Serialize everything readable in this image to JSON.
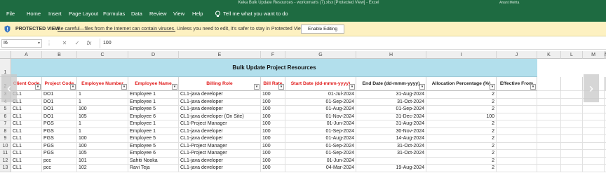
{
  "window": {
    "title": "Keka Bulk Update Resources - workomarts (7).xlsx  [Protected View]  -  Excel",
    "user": "Anant Mehta"
  },
  "ribbon": {
    "tabs": [
      "File",
      "Home",
      "Insert",
      "Page Layout",
      "Formulas",
      "Data",
      "Review",
      "View",
      "Help"
    ],
    "tell_me": "Tell me what you want to do"
  },
  "protected_view": {
    "label": "PROTECTED VIEW",
    "message_link": "Be careful—files from the Internet can contain viruses.",
    "message_rest": " Unless you need to edit, it's safer to stay in Protected View.",
    "button": "Enable Editing"
  },
  "formula_bar": {
    "name_box": "I6",
    "sep": "⋮",
    "cancel": "✕",
    "enter": "✓",
    "fx": "fx",
    "value": "100"
  },
  "columns": [
    "A",
    "B",
    "C",
    "D",
    "E",
    "F",
    "G",
    "H",
    "I",
    "J",
    "K",
    "L",
    "M",
    "N"
  ],
  "row_numbers": [
    "1",
    "2",
    "3",
    "4",
    "5",
    "6",
    "7",
    "8",
    "9",
    "10",
    "11",
    "12",
    "13"
  ],
  "sheet": {
    "banner": "Bulk Update Project Resources",
    "headers": [
      "Client Code",
      "Project Code",
      "Employee Number",
      "Employee Name",
      "Billing Role",
      "Bill Rate",
      "Start Date (dd-mmm-yyyy)",
      "End Date (dd-mmm-yyyy)",
      "Allocation Percentage (%)",
      "Effective From"
    ],
    "rows": [
      [
        "CL1",
        "DO1",
        "1",
        "Employee 1",
        "CL1-java developer",
        "100",
        "01-Jul-2024",
        "31-Aug-2024",
        "2",
        ""
      ],
      [
        "CL1",
        "DO1",
        "1",
        "Employee 1",
        "CL1-java developer",
        "100",
        "01-Sep-2024",
        "31-Oct-2024",
        "2",
        ""
      ],
      [
        "CL1",
        "DO1",
        "100",
        "Employee 5",
        "CL1-java developer",
        "100",
        "01-Aug-2024",
        "01-Sep-2024",
        "2",
        ""
      ],
      [
        "CL1",
        "DO1",
        "105",
        "Employee 6",
        "CL1-java developer (On Site)",
        "100",
        "01-Nov-2024",
        "31-Dec-2024",
        "100",
        ""
      ],
      [
        "CL1",
        "PGS",
        "1",
        "Employee 1",
        "CL1-Project Manager",
        "100",
        "01-Jun-2024",
        "31-Aug-2024",
        "2",
        ""
      ],
      [
        "CL1",
        "PGS",
        "1",
        "Employee 1",
        "CL1-java developer",
        "100",
        "01-Sep-2024",
        "30-Nov-2024",
        "2",
        ""
      ],
      [
        "CL1",
        "PGS",
        "100",
        "Employee 5",
        "CL1-java developer",
        "100",
        "01-Aug-2024",
        "14-Aug-2024",
        "2",
        ""
      ],
      [
        "CL1",
        "PGS",
        "100",
        "Employee 5",
        "CL1-Project Manager",
        "100",
        "01-Sep-2024",
        "31-Oct-2024",
        "2",
        ""
      ],
      [
        "CL1",
        "PGS",
        "105",
        "Employee 6",
        "CL1-Project Manager",
        "100",
        "01-Sep-2024",
        "31-Oct-2024",
        "2",
        ""
      ],
      [
        "CL1",
        "pcc",
        "101",
        "Sahiti Nooka",
        "CL1-java developer",
        "100",
        "01-Jun-2024",
        "",
        "2",
        ""
      ],
      [
        "CL1",
        "pcc",
        "102",
        "Ravi Teja",
        "CL1-java developer",
        "100",
        "04-Mar-2024",
        "19-Aug-2024",
        "2",
        ""
      ]
    ]
  },
  "nav": {
    "prev": "‹",
    "next": "›"
  },
  "colors": {
    "excel_green": "#1e6b41",
    "banner_blue": "#b2dfec",
    "header_red": "#e01a1a",
    "pv_bar": "#fdf1c1"
  },
  "icons": {
    "bulb": "lightbulb-icon",
    "shield": "shield-icon",
    "filter": "filter-dropdown-icon"
  }
}
